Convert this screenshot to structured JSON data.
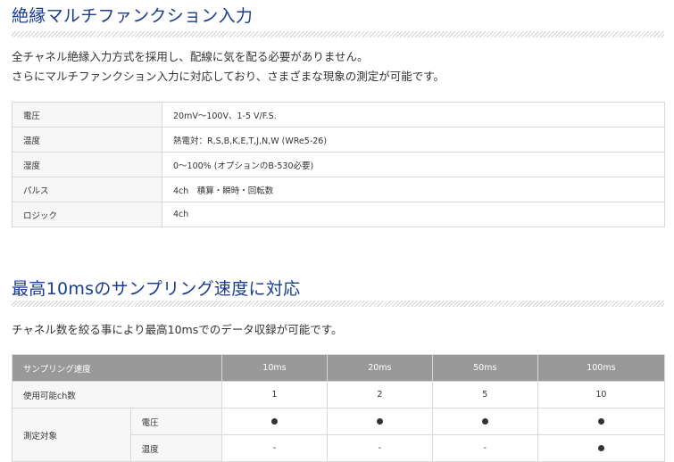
{
  "section1": {
    "title": "絶縁マルチファンクション入力",
    "lines": [
      "全チャネル絶縁入力方式を採用し、配線に気を配る必要がありません。",
      "さらにマルチファンクション入力に対応しており、さまざまな現象の測定が可能です。"
    ],
    "spec_rows": [
      {
        "label": "電圧",
        "value": "20mV～100V、1-5 V/F.S."
      },
      {
        "label": "温度",
        "value": "熱電対：R,S,B,K,E,T,J,N,W (WRe5-26)"
      },
      {
        "label": "湿度",
        "value": "0～100% (オプションのB-530必要)"
      },
      {
        "label": "パルス",
        "value": "4ch　積算・瞬時・回転数"
      },
      {
        "label": "ロジック",
        "value": "4ch"
      }
    ]
  },
  "section2": {
    "title": "最高10msのサンプリング速度に対応",
    "line": "チャネル数を絞る事により最高10msでのデータ収録が可能です。",
    "table": {
      "header_label": "サンプリング速度",
      "speeds": [
        "10ms",
        "20ms",
        "50ms",
        "100ms"
      ],
      "channels_label": "使用可能ch数",
      "channels": [
        "1",
        "2",
        "5",
        "10"
      ],
      "target_label": "測定対象",
      "targets": [
        {
          "name": "電圧",
          "marks": [
            "●",
            "●",
            "●",
            "●"
          ]
        },
        {
          "name": "温度",
          "marks": [
            "-",
            "-",
            "-",
            "●"
          ]
        }
      ]
    }
  }
}
